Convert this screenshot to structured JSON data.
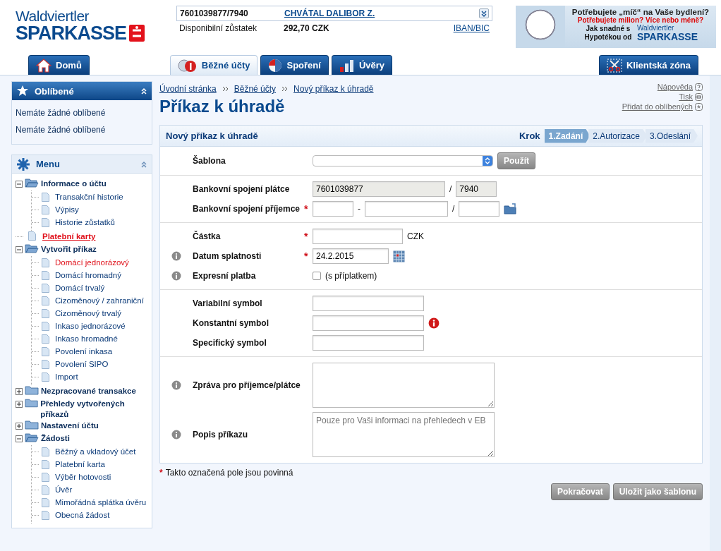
{
  "logo": {
    "line1": "Waldviertler",
    "line2": "SPARKASSE"
  },
  "account": {
    "number": "7601039877/7940",
    "owner": "CHVÁTAL DALIBOR Z.",
    "balance_label": "Disponibilní zůstatek",
    "balance": "292,70 CZK",
    "iban_link": "IBAN/BIC"
  },
  "ad": {
    "headline": "Potřebujete „míč“ na Vaše bydlení?",
    "subline": "Potřebujete milion? Více nebo méně?",
    "text": "Jak snadné s Hypotékou od",
    "brand_line1": "Waldviertler",
    "brand_line2": "SPARKASSE"
  },
  "nav_tabs": [
    {
      "label": "Domů",
      "selected": false
    },
    {
      "label": "Běžné účty",
      "selected": true
    },
    {
      "label": "Spoření",
      "selected": false
    },
    {
      "label": "Úvěry",
      "selected": false
    },
    {
      "label": "Klientská zóna",
      "selected": false
    }
  ],
  "favorites": {
    "title": "Oblíbené",
    "items": [
      "Nemáte žádné oblíbené",
      "Nemáte žádné oblíbené"
    ]
  },
  "menu": {
    "title": "Menu",
    "items": [
      {
        "label": "Informace o účtu",
        "kind": "folder",
        "expanded": true,
        "active": false,
        "children": [
          {
            "label": "Transakční historie",
            "kind": "page",
            "active": false
          },
          {
            "label": "Výpisy",
            "kind": "page",
            "active": false
          },
          {
            "label": "Historie zůstatků",
            "kind": "page",
            "active": false
          }
        ]
      },
      {
        "label": "Platební karty",
        "kind": "page",
        "active": true
      },
      {
        "label": "Vytvořit příkaz",
        "kind": "folder",
        "expanded": true,
        "active": false,
        "children": [
          {
            "label": "Domácí jednorázový",
            "kind": "page",
            "active": true
          },
          {
            "label": "Domácí hromadný",
            "kind": "page",
            "active": false
          },
          {
            "label": "Domácí trvalý",
            "kind": "page",
            "active": false
          },
          {
            "label": "Cizoměnový / zahraniční",
            "kind": "page",
            "active": false
          },
          {
            "label": "Cizoměnový trvalý",
            "kind": "page",
            "active": false
          },
          {
            "label": "Inkaso jednorázové",
            "kind": "page",
            "active": false
          },
          {
            "label": "Inkaso hromadné",
            "kind": "page",
            "active": false
          },
          {
            "label": "Povolení inkasa",
            "kind": "page",
            "active": false
          },
          {
            "label": "Povolení SIPO",
            "kind": "page",
            "active": false
          },
          {
            "label": "Import",
            "kind": "page",
            "active": false
          }
        ]
      },
      {
        "label": "Nezpracované transakce",
        "kind": "folder",
        "expanded": false,
        "active": false
      },
      {
        "label": "Přehledy vytvořených příkazů",
        "kind": "folder",
        "expanded": false,
        "active": false
      },
      {
        "label": "Nastavení účtu",
        "kind": "folder",
        "expanded": false,
        "active": false
      },
      {
        "label": "Žádosti",
        "kind": "folder",
        "expanded": true,
        "active": false,
        "children": [
          {
            "label": "Běžný a vkladový účet",
            "kind": "page",
            "active": false
          },
          {
            "label": "Platební karta",
            "kind": "page",
            "active": false
          },
          {
            "label": "Výběr hotovosti",
            "kind": "page",
            "active": false
          },
          {
            "label": "Úvěr",
            "kind": "page",
            "active": false
          },
          {
            "label": "Mimořádná splátka úvěru",
            "kind": "page",
            "active": false
          },
          {
            "label": "Obecná žádost",
            "kind": "page",
            "active": false
          }
        ]
      }
    ]
  },
  "breadcrumbs": [
    "Úvodní stránka",
    "Běžné účty",
    "Nový příkaz k úhradě"
  ],
  "page_title": "Příkaz k úhradě",
  "page_links": [
    "Nápověda",
    "Tisk",
    "Přidat do oblíbených"
  ],
  "form": {
    "title": "Nový příkaz k úhradě",
    "steps_label": "Krok",
    "required_mark": "*",
    "steps": [
      {
        "label": "1.Zadání",
        "selected": true
      },
      {
        "label": "2.Autorizace",
        "selected": false
      },
      {
        "label": "3.Odeslání",
        "selected": false
      }
    ],
    "sections": [
      [
        {
          "kind": "select",
          "label": "Šablona",
          "required": false,
          "info": false,
          "button": "Použít"
        }
      ],
      [
        {
          "kind": "payer",
          "label": "Bankovní spojení plátce",
          "required": false,
          "info": false,
          "account": "7601039877",
          "separator": "/",
          "bank": "7940"
        },
        {
          "kind": "recipient",
          "label": "Bankovní spojení příjemce",
          "required": true,
          "info": false,
          "dash": "-",
          "separator": "/"
        }
      ],
      [
        {
          "kind": "text",
          "label": "Částka",
          "required": true,
          "info": false,
          "suffix": "CZK"
        },
        {
          "kind": "date",
          "label": "Datum splatnosti",
          "required": true,
          "info": true,
          "value": "24.2.2015"
        },
        {
          "kind": "checkbox",
          "label": "Expresní platba",
          "required": false,
          "info": true,
          "checked": false,
          "suffix": "(s příplatkem)"
        }
      ],
      [
        {
          "kind": "text",
          "label": "Variabilní symbol",
          "required": false,
          "info": false
        },
        {
          "kind": "text",
          "label": "Konstantní symbol",
          "required": false,
          "info": false,
          "warning": true
        },
        {
          "kind": "text",
          "label": "Specifický symbol",
          "required": false,
          "info": false
        }
      ],
      [
        {
          "kind": "textarea",
          "label": "Zpráva pro příjemce/plátce",
          "required": false,
          "info": true
        },
        {
          "kind": "textarea",
          "label": "Popis příkazu",
          "required": false,
          "info": true,
          "placeholder": "Pouze pro Vaši informaci na přehledech v EB"
        }
      ]
    ],
    "required_note": "Takto označená pole jsou povinná",
    "buttons": [
      "Pokračovat",
      "Uložit jako šablonu"
    ]
  }
}
